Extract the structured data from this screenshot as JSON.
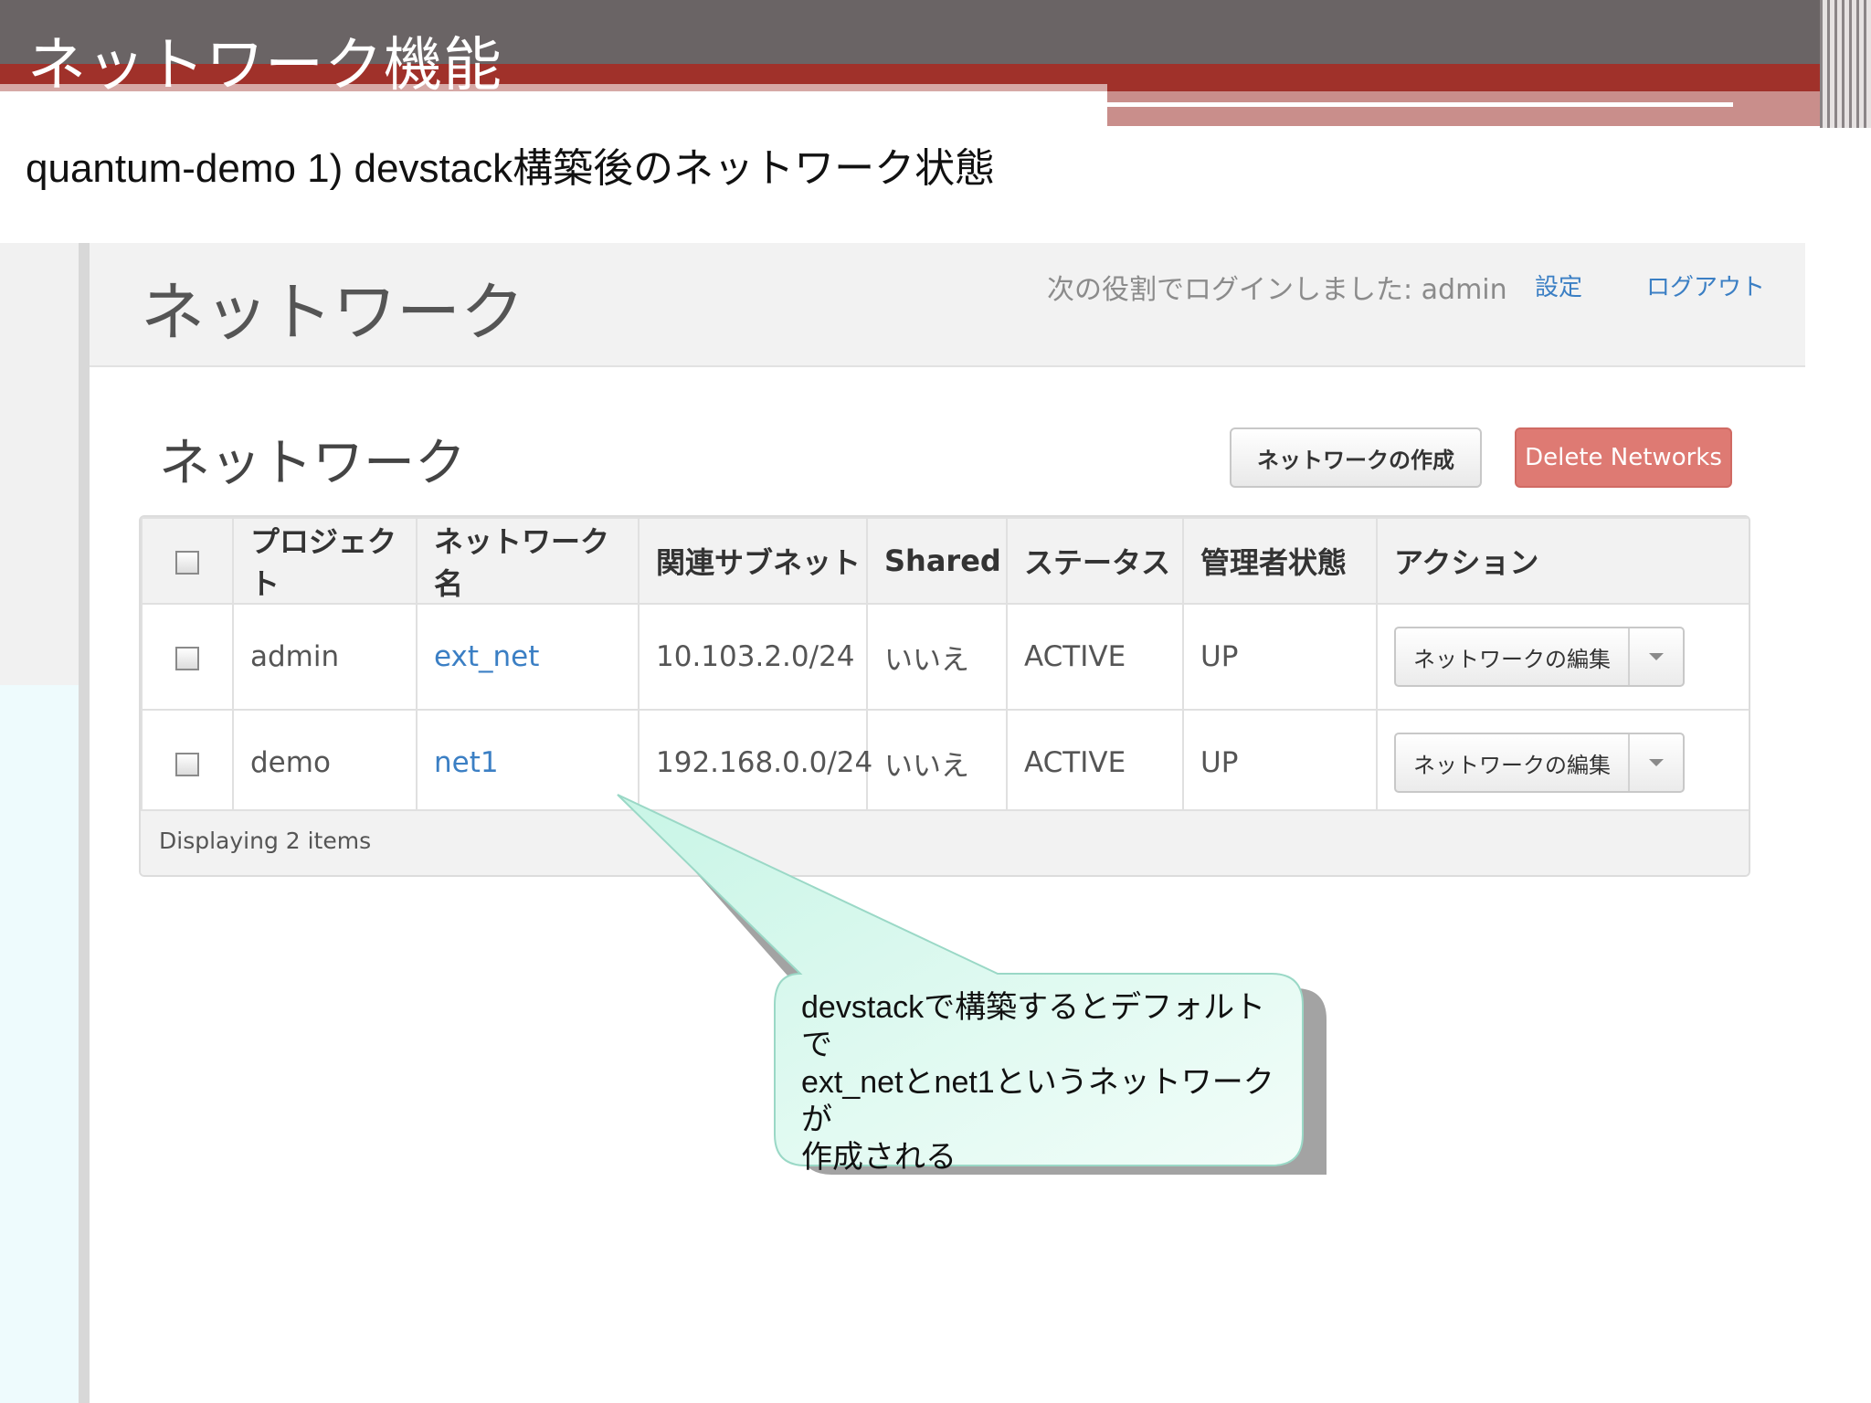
{
  "slide": {
    "title": "ネットワーク機能",
    "subtitle": "quantum-demo 1) devstack構築後のネットワーク状態"
  },
  "app": {
    "header_title": "ネットワーク",
    "login_text": "次の役割でログインしました: admin",
    "settings_label": "設定",
    "logout_label": "ログアウト"
  },
  "section": {
    "title": "ネットワーク",
    "create_button": "ネットワークの作成",
    "delete_button": "Delete Networks"
  },
  "table": {
    "headers": [
      "プロジェクト",
      "ネットワーク名",
      "関連サブネット",
      "Shared",
      "ステータス",
      "管理者状態",
      "アクション"
    ],
    "rows": [
      {
        "project": "admin",
        "name": "ext_net",
        "subnet": "10.103.2.0/24",
        "shared": "いいえ",
        "status": "ACTIVE",
        "admin_state": "UP",
        "action": "ネットワークの編集"
      },
      {
        "project": "demo",
        "name": "net1",
        "subnet": "192.168.0.0/24",
        "shared": "いいえ",
        "status": "ACTIVE",
        "admin_state": "UP",
        "action": "ネットワークの編集"
      }
    ],
    "footer": "Displaying 2 items"
  },
  "callout": {
    "lines": [
      "devstackで構築するとデフォルトで",
      "ext_netとnet1というネットワークが",
      "作成される"
    ]
  },
  "colors": {
    "slide_band_gray": "#6a6465",
    "slide_band_red": "#a0312a",
    "link_blue": "#3b7fc4",
    "delete_button": "#de7a73",
    "callout_fill": "#e6fbf3"
  }
}
